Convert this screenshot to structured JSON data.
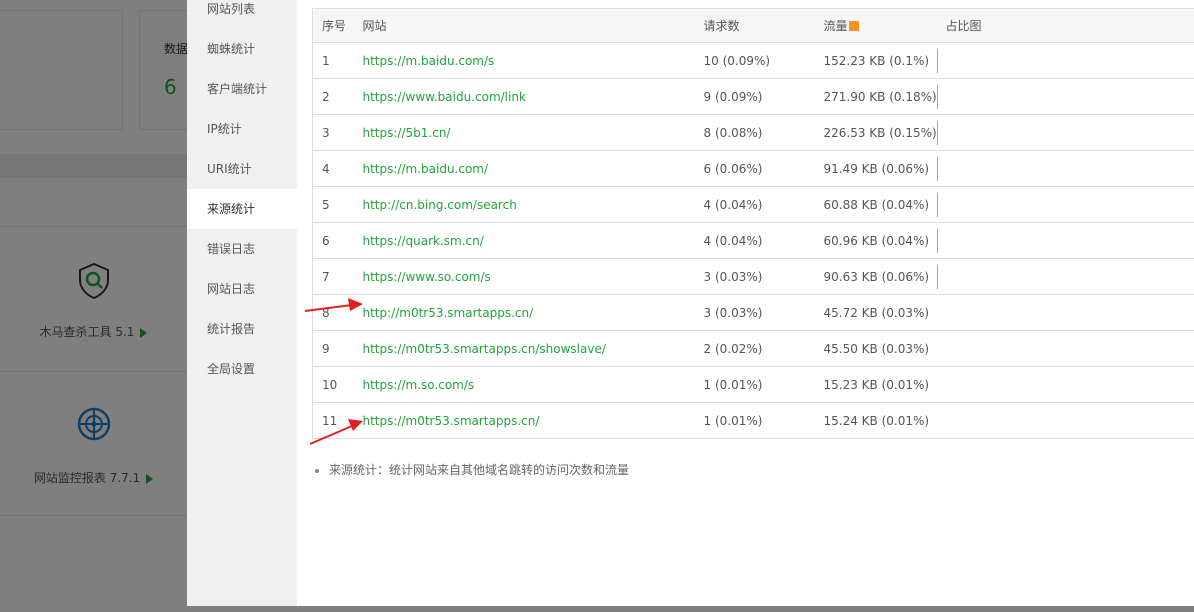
{
  "background": {
    "card_text_partial": "数据",
    "card_number": "6",
    "tools": [
      {
        "label": "木马查杀工具 5.1",
        "icon": "trojan-scan-icon"
      },
      {
        "label": "网站监控报表 7.7.1",
        "icon": "site-monitor-icon"
      }
    ]
  },
  "sidebar": {
    "items": [
      {
        "label": "网站列表"
      },
      {
        "label": "蜘蛛统计"
      },
      {
        "label": "客户端统计"
      },
      {
        "label": "IP统计"
      },
      {
        "label": "URI统计"
      },
      {
        "label": "来源统计",
        "active": true
      },
      {
        "label": "错误日志"
      },
      {
        "label": "网站日志"
      },
      {
        "label": "统计报告"
      },
      {
        "label": "全局设置"
      }
    ]
  },
  "table": {
    "headers": {
      "index": "序号",
      "site": "网站",
      "requests": "请求数",
      "flow": "流量",
      "share": "占比图"
    },
    "rows": [
      {
        "index": "1",
        "site": "https://m.baidu.com/s",
        "requests": "10 (0.09%)",
        "flow": "152.23 KB (0.1%)",
        "share": 0.1
      },
      {
        "index": "2",
        "site": "https://www.baidu.com/link",
        "requests": "9 (0.09%)",
        "flow": "271.90 KB (0.18%)",
        "share": 0.18
      },
      {
        "index": "3",
        "site": "https://5b1.cn/",
        "requests": "8 (0.08%)",
        "flow": "226.53 KB (0.15%)",
        "share": 0.15
      },
      {
        "index": "4",
        "site": "https://m.baidu.com/",
        "requests": "6 (0.06%)",
        "flow": "91.49 KB (0.06%)",
        "share": 0.06
      },
      {
        "index": "5",
        "site": "http://cn.bing.com/search",
        "requests": "4 (0.04%)",
        "flow": "60.88 KB (0.04%)",
        "share": 0.04
      },
      {
        "index": "6",
        "site": "https://quark.sm.cn/",
        "requests": "4 (0.04%)",
        "flow": "60.96 KB (0.04%)",
        "share": 0.04
      },
      {
        "index": "7",
        "site": "https://www.so.com/s",
        "requests": "3 (0.03%)",
        "flow": "90.63 KB (0.06%)",
        "share": 0.06
      },
      {
        "index": "8",
        "site": "http://m0tr53.smartapps.cn/",
        "requests": "3 (0.03%)",
        "flow": "45.72 KB (0.03%)",
        "share": 0.03
      },
      {
        "index": "9",
        "site": "https://m0tr53.smartapps.cn/showslave/",
        "requests": "2 (0.02%)",
        "flow": "45.50 KB (0.03%)",
        "share": 0.03
      },
      {
        "index": "10",
        "site": "https://m.so.com/s",
        "requests": "1 (0.01%)",
        "flow": "15.23 KB (0.01%)",
        "share": 0.01
      },
      {
        "index": "11",
        "site": "https://m0tr53.smartapps.cn/",
        "requests": "1 (0.01%)",
        "flow": "15.24 KB (0.01%)",
        "share": 0.01
      }
    ]
  },
  "note": "来源统计：统计网站来自其他域名跳转的访问次数和流量",
  "colors": {
    "link": "#20a53a",
    "bar": "#f7931e",
    "arrow": "#e02020"
  }
}
